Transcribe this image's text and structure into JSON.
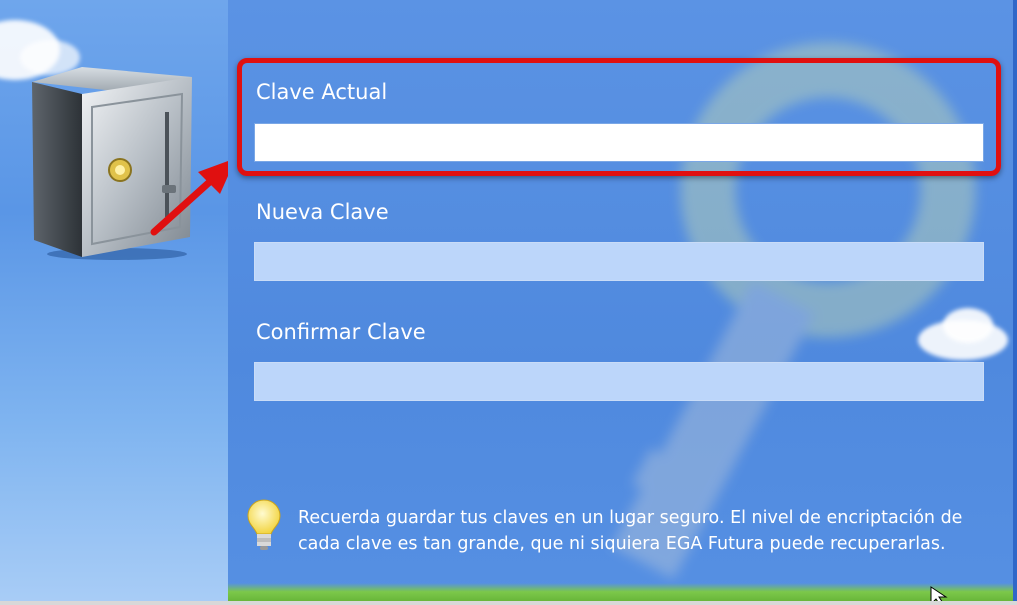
{
  "form": {
    "current_password_label": "Clave Actual",
    "current_password_value": "",
    "new_password_label": "Nueva Clave",
    "new_password_value": "",
    "confirm_password_label": "Confirmar Clave",
    "confirm_password_value": ""
  },
  "hint": {
    "text": "Recuerda guardar tus claves en un lugar seguro. El nivel de encriptación de cada clave es tan grande, que ni siquiera EGA Futura puede recuperarlas.",
    "icon": "lightbulb-icon"
  },
  "decor": {
    "illustration": "safe-icon",
    "annotation_color": "#e01010",
    "sky_color": "#5a96e6"
  }
}
